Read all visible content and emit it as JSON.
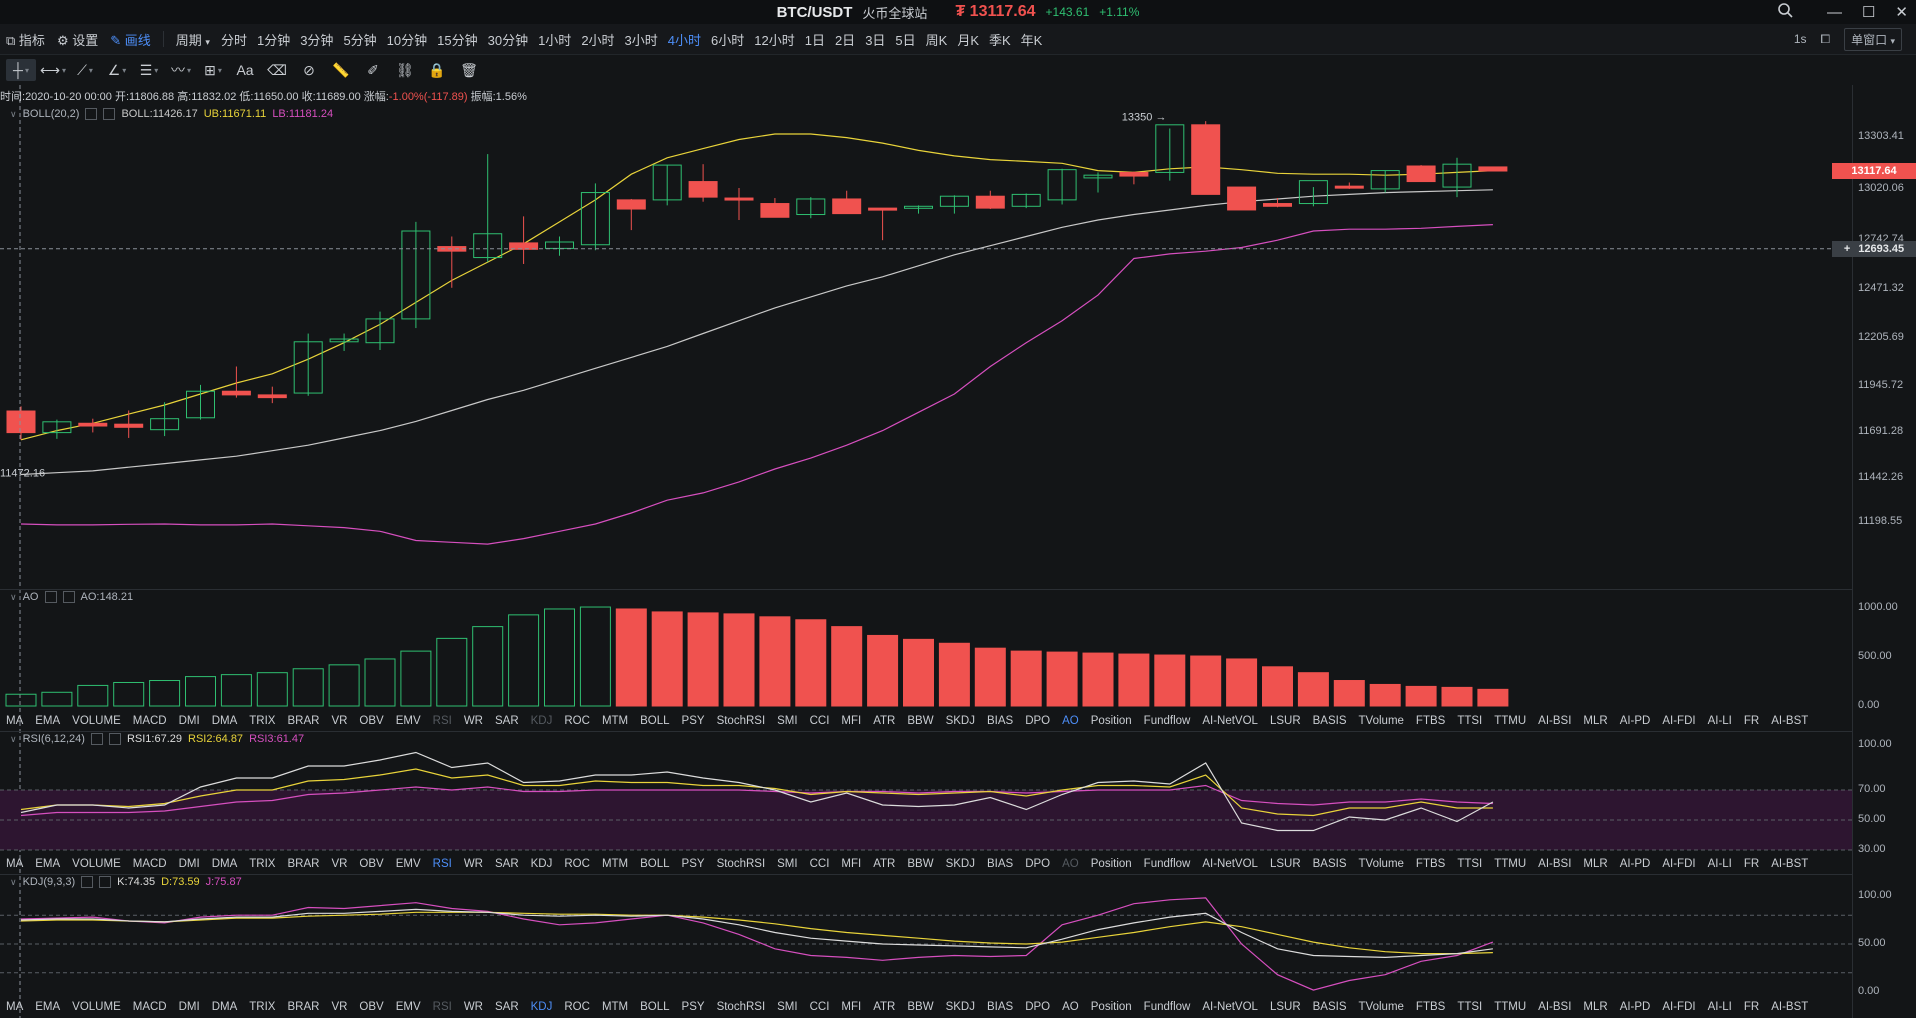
{
  "titlebar": {
    "pair": "BTC/USDT",
    "exchange": "火币全球站",
    "currency_symbol": "₮",
    "price": "13117.64",
    "change": "+143.61",
    "change_pct": "+1.11%"
  },
  "toolbar1": {
    "indicator": "指标",
    "settings": "设置",
    "draw": "画线",
    "period": "周期",
    "timeframes": [
      "分时",
      "1分钟",
      "3分钟",
      "5分钟",
      "10分钟",
      "15分钟",
      "30分钟",
      "1小时",
      "2小时",
      "3小时",
      "4小时",
      "6小时",
      "12小时",
      "1日",
      "2日",
      "3日",
      "5日",
      "周K",
      "月K",
      "季K",
      "年K"
    ],
    "active_timeframe": "4小时",
    "refresh": "1s",
    "window_mode": "单窗口"
  },
  "info": {
    "time_label": "时间:",
    "time": "2020-10-20 00:00",
    "open_label": "开:",
    "open": "11806.88",
    "high_label": "高:",
    "high": "11832.02",
    "low_label": "低:",
    "low": "11650.00",
    "close_label": "收:",
    "close": "11689.00",
    "change_label": "涨幅:",
    "change": "-1.00%(-117.89)",
    "amp_label": "振幅:",
    "amp": "1.56%"
  },
  "boll": {
    "name": "BOLL(20,2)",
    "mid": "BOLL:11426.17",
    "ub": "UB:11671.11",
    "lb": "LB:11181.24"
  },
  "ao": {
    "name": "AO",
    "value": "AO:148.21"
  },
  "rsi": {
    "name": "RSI(6,12,24)",
    "r1": "RSI1:67.29",
    "r2": "RSI2:64.87",
    "r3": "RSI3:61.47"
  },
  "kdj": {
    "name": "KDJ(9,3,3)",
    "k": "K:74.35",
    "d": "D:73.59",
    "j": "J:75.87"
  },
  "indicator_tabs": [
    "MA",
    "EMA",
    "VOLUME",
    "MACD",
    "DMI",
    "DMA",
    "TRIX",
    "BRAR",
    "VR",
    "OBV",
    "EMV",
    "RSI",
    "WR",
    "SAR",
    "KDJ",
    "ROC",
    "MTM",
    "BOLL",
    "PSY",
    "StochRSI",
    "SMI",
    "CCI",
    "MFI",
    "ATR",
    "BBW",
    "SKDJ",
    "BIAS",
    "DPO",
    "AO",
    "Position",
    "Fundflow",
    "AI-NetVOL",
    "LSUR",
    "BASIS",
    "TVolume",
    "FTBS",
    "TTSI",
    "TTMU",
    "AI-BSI",
    "MLR",
    "AI-PD",
    "AI-FDI",
    "AI-LI",
    "FR",
    "AI-BST"
  ],
  "tabs_state": {
    "row1": {
      "active": "AO",
      "disabled": [
        "RSI",
        "KDJ"
      ]
    },
    "row2": {
      "active": "RSI",
      "disabled": [
        "AO"
      ]
    },
    "row3": {
      "active": "KDJ",
      "disabled": [
        "RSI"
      ]
    }
  },
  "price_axis": {
    "ticks": [
      "13303.41",
      "13020.06",
      "12742.74",
      "12471.32",
      "12205.69",
      "11945.72",
      "11691.28",
      "11442.26",
      "11198.55"
    ],
    "current_price": "13117.64",
    "crosshair_price": "12693.45",
    "crosshair_plus": "+",
    "left_label": "11472.16",
    "high_marker": "13350"
  },
  "ao_axis": [
    "1000.00",
    "500.00",
    "0.00"
  ],
  "rsi_axis": [
    "100.00",
    "70.00",
    "50.00",
    "30.00"
  ],
  "kdj_axis": [
    "100.00",
    "50.00",
    "0.00"
  ],
  "colors": {
    "up": "#2fbf71",
    "down": "#f0524f",
    "boll_mid": "#c8c8c8",
    "boll_ub": "#e8d33a",
    "boll_lb": "#d64fbf",
    "accent": "#4d8ef7",
    "rsi_band": "#2d1530"
  },
  "chart_data": {
    "type": "candlestick",
    "candles": [
      [
        11806.88,
        11832.02,
        11650,
        11689
      ],
      [
        11689,
        11760,
        11655,
        11748
      ],
      [
        11740,
        11765,
        11690,
        11725
      ],
      [
        11735,
        11810,
        11660,
        11718
      ],
      [
        11705,
        11855,
        11670,
        11765
      ],
      [
        11770,
        11950,
        11760,
        11915
      ],
      [
        11915,
        12050,
        11880,
        11895
      ],
      [
        11895,
        11940,
        11850,
        11880
      ],
      [
        11905,
        12230,
        11890,
        12185
      ],
      [
        12185,
        12230,
        12135,
        12200
      ],
      [
        12180,
        12350,
        12140,
        12310
      ],
      [
        12310,
        12840,
        12260,
        12790
      ],
      [
        12705,
        12760,
        12480,
        12680
      ],
      [
        12645,
        13210,
        12620,
        12775
      ],
      [
        12725,
        12870,
        12610,
        12690
      ],
      [
        12695,
        12760,
        12655,
        12730
      ],
      [
        12715,
        13050,
        12685,
        13000
      ],
      [
        12960,
        12965,
        12795,
        12910
      ],
      [
        12960,
        13150,
        12930,
        13150
      ],
      [
        13060,
        13155,
        12950,
        12975
      ],
      [
        12970,
        13025,
        12850,
        12960
      ],
      [
        12940,
        12970,
        12865,
        12865
      ],
      [
        12880,
        12975,
        12860,
        12965
      ],
      [
        12965,
        13010,
        12900,
        12885
      ],
      [
        12915,
        12915,
        12740,
        12905
      ],
      [
        12915,
        12930,
        12885,
        12925
      ],
      [
        12925,
        12985,
        12885,
        12980
      ],
      [
        12980,
        13010,
        12910,
        12915
      ],
      [
        12925,
        12995,
        12915,
        12990
      ],
      [
        12960,
        13130,
        12935,
        13125
      ],
      [
        13080,
        13110,
        13000,
        13095
      ],
      [
        13110,
        13115,
        13045,
        13090
      ],
      [
        13110,
        13350,
        13065,
        13370
      ],
      [
        13370,
        13390,
        13040,
        12990
      ],
      [
        13030,
        13030,
        12980,
        12905
      ],
      [
        12940,
        12970,
        12920,
        12925
      ],
      [
        12940,
        13030,
        12925,
        13065
      ],
      [
        13035,
        13055,
        13020,
        13025
      ],
      [
        13020,
        13120,
        13000,
        13120
      ],
      [
        13145,
        13150,
        13060,
        13060
      ],
      [
        13030,
        13190,
        12975,
        13155
      ],
      [
        13140,
        13120,
        13115,
        13117.64
      ]
    ],
    "boll_mid": [
      11460,
      11470,
      11480,
      11500,
      11520,
      11540,
      11560,
      11590,
      11620,
      11660,
      11700,
      11750,
      11810,
      11870,
      11920,
      11980,
      12040,
      12100,
      12160,
      12230,
      12300,
      12370,
      12430,
      12490,
      12540,
      12600,
      12660,
      12710,
      12760,
      12810,
      12850,
      12880,
      12905,
      12930,
      12950,
      12965,
      12980,
      12990,
      13000,
      13005,
      13010,
      13015
    ],
    "boll_ub": [
      11650,
      11700,
      11740,
      11790,
      11840,
      11900,
      11960,
      12010,
      12090,
      12180,
      12280,
      12400,
      12520,
      12620,
      12720,
      12840,
      12960,
      13100,
      13190,
      13240,
      13290,
      13320,
      13320,
      13300,
      13270,
      13230,
      13200,
      13180,
      13170,
      13160,
      13120,
      13110,
      13130,
      13140,
      13125,
      13105,
      13100,
      13100,
      13095,
      13100,
      13110,
      13120
    ],
    "boll_lb": [
      11190,
      11185,
      11185,
      11188,
      11190,
      11185,
      11185,
      11190,
      11180,
      11170,
      11150,
      11100,
      11090,
      11080,
      11110,
      11150,
      11190,
      11250,
      11320,
      11360,
      11420,
      11490,
      11550,
      11620,
      11700,
      11800,
      11900,
      12050,
      12180,
      12300,
      12440,
      12640,
      12665,
      12680,
      12700,
      12740,
      12790,
      12800,
      12800,
      12805,
      12815,
      12825
    ],
    "ao": [
      120,
      140,
      210,
      240,
      260,
      300,
      320,
      340,
      380,
      420,
      480,
      560,
      690,
      810,
      930,
      990,
      1010,
      990,
      960,
      950,
      940,
      910,
      880,
      810,
      720,
      680,
      640,
      590,
      560,
      550,
      540,
      530,
      520,
      510,
      480,
      400,
      340,
      260,
      220,
      200,
      190,
      170
    ],
    "rsi": {
      "rsi1": [
        55,
        60,
        60,
        58,
        60,
        72,
        78,
        78,
        86,
        86,
        90,
        95,
        85,
        88,
        75,
        76,
        80,
        80,
        82,
        78,
        75,
        70,
        62,
        68,
        60,
        59,
        60,
        65,
        57,
        67,
        75,
        76,
        74,
        88,
        48,
        43,
        43,
        52,
        50,
        58,
        49,
        62
      ],
      "rsi2": [
        57,
        60,
        60,
        59,
        61,
        66,
        70,
        70,
        76,
        77,
        80,
        84,
        78,
        80,
        73,
        73,
        76,
        75,
        75,
        73,
        73,
        71,
        67,
        69,
        68,
        67,
        68,
        69,
        66,
        70,
        73,
        73,
        72,
        80,
        58,
        54,
        53,
        58,
        58,
        62,
        58,
        58
      ],
      "rsi3": [
        53,
        55,
        55,
        55,
        56,
        59,
        62,
        63,
        67,
        68,
        70,
        72,
        70,
        72,
        69,
        69,
        70,
        70,
        70,
        70,
        70,
        69,
        68,
        69,
        69,
        68,
        69,
        69,
        68,
        69,
        70,
        70,
        70,
        73,
        63,
        61,
        60,
        62,
        62,
        64,
        62,
        61
      ]
    },
    "kdj": {
      "k": [
        75,
        76,
        76,
        74,
        73,
        76,
        78,
        78,
        82,
        82,
        84,
        86,
        84,
        83,
        80,
        79,
        80,
        79,
        80,
        76,
        70,
        62,
        56,
        53,
        50,
        49,
        48,
        47,
        46,
        55,
        65,
        72,
        78,
        82,
        62,
        45,
        38,
        37,
        36,
        38,
        40,
        45
      ],
      "d": [
        74,
        75,
        75,
        74,
        73,
        75,
        77,
        77,
        79,
        80,
        81,
        83,
        83,
        83,
        82,
        81,
        81,
        80,
        80,
        78,
        75,
        71,
        66,
        62,
        59,
        56,
        53,
        51,
        50,
        52,
        57,
        62,
        68,
        73,
        68,
        60,
        52,
        46,
        42,
        40,
        40,
        41
      ],
      "j": [
        76,
        77,
        78,
        74,
        72,
        78,
        80,
        80,
        88,
        87,
        90,
        93,
        87,
        84,
        76,
        70,
        72,
        76,
        80,
        72,
        60,
        45,
        38,
        36,
        33,
        36,
        38,
        37,
        38,
        70,
        80,
        92,
        96,
        98,
        50,
        18,
        2,
        12,
        18,
        32,
        38,
        52
      ]
    }
  }
}
